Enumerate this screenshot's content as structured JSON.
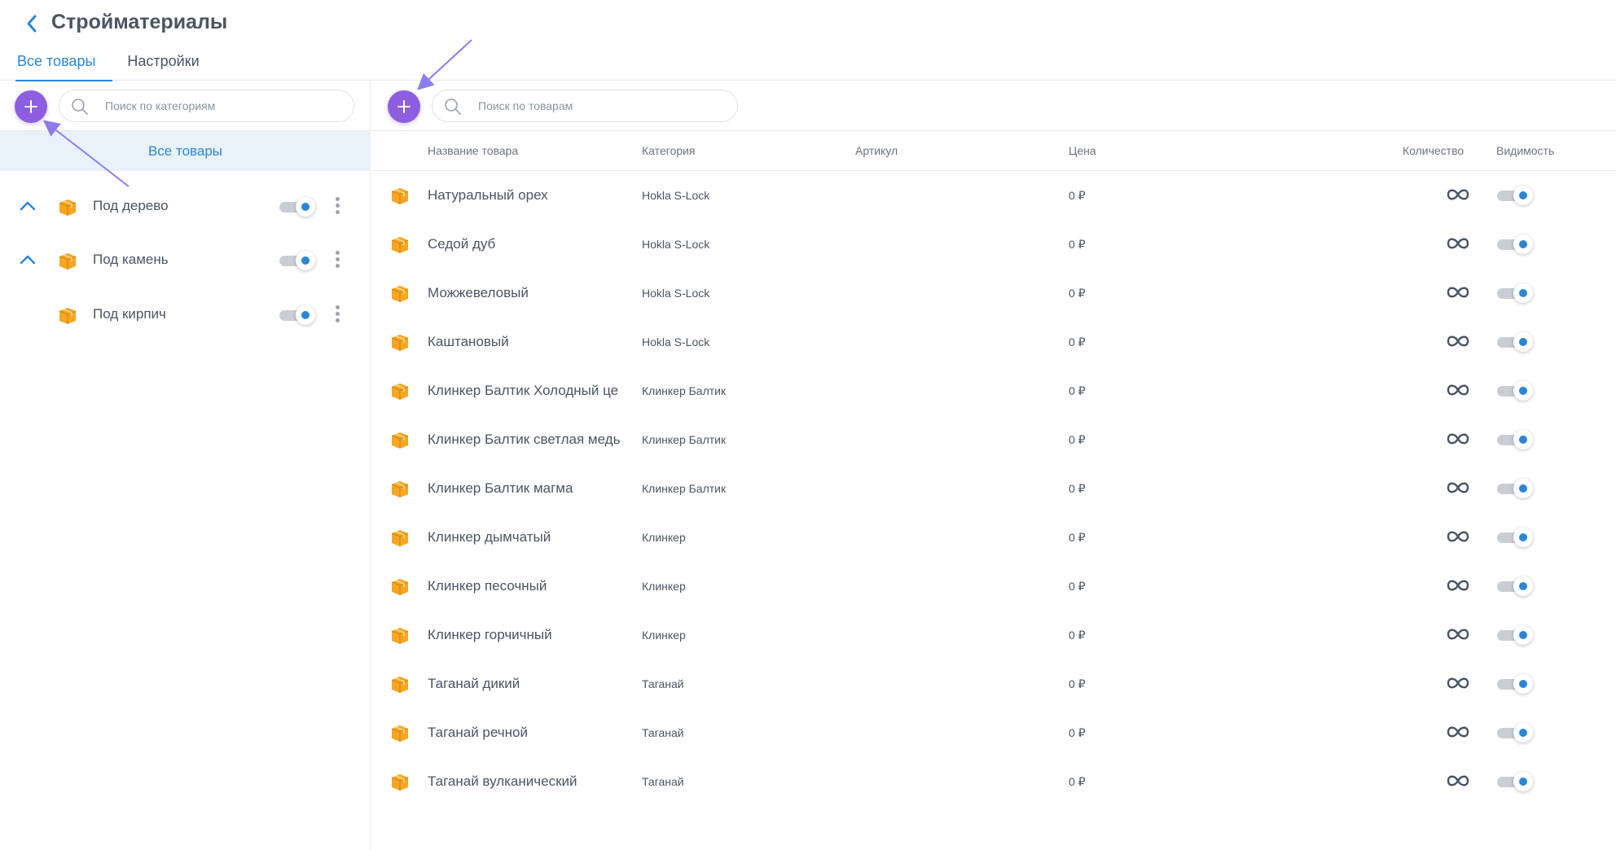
{
  "header": {
    "title": "Стройматериалы",
    "tabs": [
      {
        "label": "Все товары",
        "active": true
      },
      {
        "label": "Настройки",
        "active": false
      }
    ]
  },
  "categories_panel": {
    "search_placeholder": "Поиск по категориям",
    "all_products_label": "Все товары",
    "items": [
      {
        "label": "Под дерево",
        "expandable": true,
        "visible": true
      },
      {
        "label": "Под камень",
        "expandable": true,
        "visible": true
      },
      {
        "label": "Под кирпич",
        "expandable": false,
        "visible": true
      }
    ]
  },
  "products_panel": {
    "search_placeholder": "Поиск по товарам",
    "columns": {
      "name": "Название товара",
      "category": "Категория",
      "sku": "Артикул",
      "price": "Цена",
      "quantity": "Количество",
      "visibility": "Видимость"
    },
    "rows": [
      {
        "name": "Натуральный орех",
        "category": "Hokla S-Lock",
        "sku": "",
        "price": "0 ₽",
        "quantity": "∞",
        "visible": true
      },
      {
        "name": "Седой дуб",
        "category": "Hokla S-Lock",
        "sku": "",
        "price": "0 ₽",
        "quantity": "∞",
        "visible": true
      },
      {
        "name": "Можжевеловый",
        "category": "Hokla S-Lock",
        "sku": "",
        "price": "0 ₽",
        "quantity": "∞",
        "visible": true
      },
      {
        "name": "Каштановый",
        "category": "Hokla S-Lock",
        "sku": "",
        "price": "0 ₽",
        "quantity": "∞",
        "visible": true
      },
      {
        "name": "Клинкер Балтик Холодный це",
        "category": "Клинкер Балтик",
        "sku": "",
        "price": "0 ₽",
        "quantity": "∞",
        "visible": true
      },
      {
        "name": "Клинкер Балтик светлая медь",
        "category": "Клинкер Балтик",
        "sku": "",
        "price": "0 ₽",
        "quantity": "∞",
        "visible": true
      },
      {
        "name": "Клинкер Балтик магма",
        "category": "Клинкер Балтик",
        "sku": "",
        "price": "0 ₽",
        "quantity": "∞",
        "visible": true
      },
      {
        "name": "Клинкер дымчатый",
        "category": "Клинкер",
        "sku": "",
        "price": "0 ₽",
        "quantity": "∞",
        "visible": true
      },
      {
        "name": "Клинкер песочный",
        "category": "Клинкер",
        "sku": "",
        "price": "0 ₽",
        "quantity": "∞",
        "visible": true
      },
      {
        "name": "Клинкер горчичный",
        "category": "Клинкер",
        "sku": "",
        "price": "0 ₽",
        "quantity": "∞",
        "visible": true
      },
      {
        "name": "Таганай дикий",
        "category": "Таганай",
        "sku": "",
        "price": "0 ₽",
        "quantity": "∞",
        "visible": true
      },
      {
        "name": "Таганай речной",
        "category": "Таганай",
        "sku": "",
        "price": "0 ₽",
        "quantity": "∞",
        "visible": true
      },
      {
        "name": "Таганай вулканический",
        "category": "Таганай",
        "sku": "",
        "price": "0 ₽",
        "quantity": "∞",
        "visible": true
      }
    ]
  },
  "icons": {
    "back": "chevron-left-icon",
    "add": "plus-icon",
    "search": "search-icon",
    "category": "box-icon",
    "expand": "chevron-up-icon",
    "menu": "more-vertical-icon",
    "quantity": "infinity-icon",
    "annotation": "arrow-annotation"
  },
  "colors": {
    "accent": "#2a86d6",
    "add_button": "#8d5ee0",
    "annotation_arrow": "#8b7cf0",
    "selected_bg": "#e9f2fb",
    "box_icon": "#f5a623"
  }
}
